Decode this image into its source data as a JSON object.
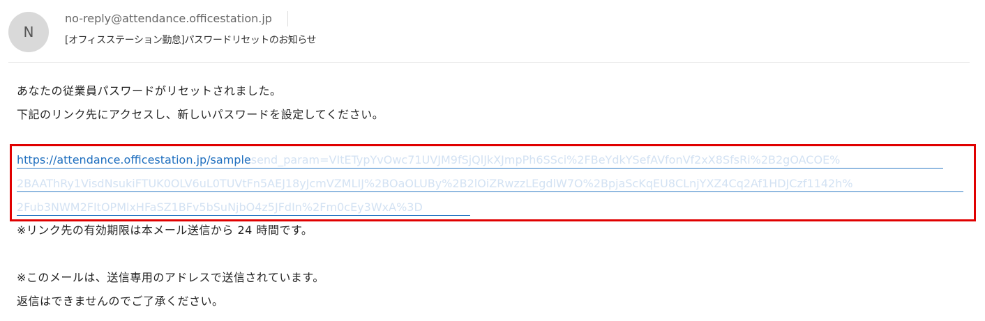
{
  "header": {
    "avatar_initial": "N",
    "sender": "no-reply@attendance.officestation.jp",
    "subject": "[オフィスステーション勤怠]パスワードリセットのお知らせ"
  },
  "body": {
    "line1": "あなたの従業員パスワードがリセットされました。",
    "line2": "下記のリンク先にアクセスし、新しいパスワードを設定してください。",
    "link_visible": "https://attendance.officestation.jp/sample",
    "link_rest_1": "send_param=VItETypYvOwc71UVJM9fSjQlJkXJmpPh6SSci%2FBeYdkYSefAVfonVf2xX8SfsRi%2B2gOACOE%",
    "link_line_2": "2BAAThRy1VisdNsukiFTUK0OLV6uL0TUVtFn5AEJ18yJcmVZMLIJ%2BOaOLUBy%2B2lOiZRwzzLEgdlW7O%2BpjaScKqEU8CLnjYXZ4Cq2Af1HDJCzf1142h%",
    "link_line_3": "2Fub3NWM2FItOPMlxHFaSZ1BFv5bSuNjbO4z5JFdIn%2Fm0cEy3WxA%3D",
    "line3": "※リンク先の有効期限は本メール送信から 24 時間です。",
    "line4": "※このメールは、送信専用のアドレスで送信されています。",
    "line5": "返信はできませんのでご了承ください。"
  },
  "colors": {
    "highlight_border": "#e00000",
    "link": "#1f6fbf",
    "link_faded": "#d3e2f3"
  }
}
